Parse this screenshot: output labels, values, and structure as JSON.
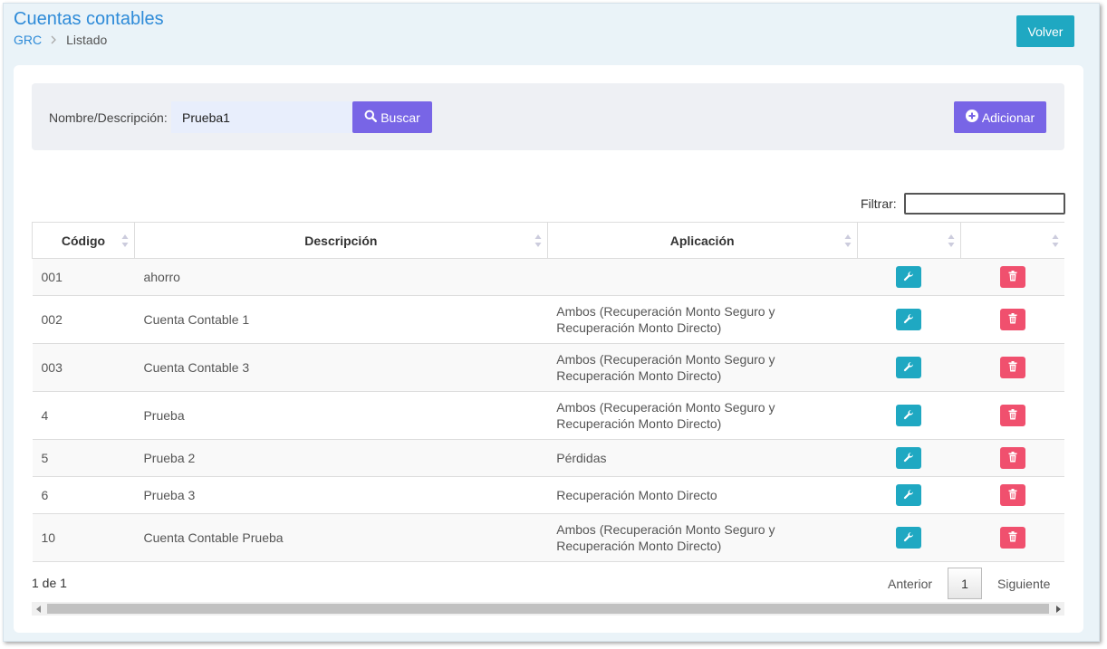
{
  "header": {
    "title": "Cuentas contables",
    "breadcrumb": {
      "root": "GRC",
      "current": "Listado"
    },
    "back_label": "Volver"
  },
  "search": {
    "label": "Nombre/Descripción:",
    "value": "Prueba1",
    "search_label": "Buscar",
    "add_label": "Adicionar"
  },
  "filter": {
    "label": "Filtrar:",
    "value": ""
  },
  "table": {
    "columns": [
      "Código",
      "Descripción",
      "Aplicación",
      "",
      ""
    ],
    "rows": [
      {
        "code": "001",
        "description": "ahorro",
        "application_1": "",
        "application_2": ""
      },
      {
        "code": "002",
        "description": "Cuenta Contable 1",
        "application_1": "Ambos (Recuperación Monto Seguro y",
        "application_2": "Recuperación Monto Directo)"
      },
      {
        "code": "003",
        "description": "Cuenta Contable 3",
        "application_1": "Ambos (Recuperación Monto Seguro y",
        "application_2": "Recuperación Monto Directo)"
      },
      {
        "code": "4",
        "description": "Prueba",
        "application_1": "Ambos (Recuperación Monto Seguro y",
        "application_2": "Recuperación Monto Directo)"
      },
      {
        "code": "5",
        "description": "Prueba 2",
        "application_1": "Pérdidas",
        "application_2": ""
      },
      {
        "code": "6",
        "description": "Prueba 3",
        "application_1": "Recuperación Monto Directo",
        "application_2": ""
      },
      {
        "code": "10",
        "description": "Cuenta Contable Prueba",
        "application_1": "Ambos (Recuperación Monto Seguro y",
        "application_2": "Recuperación Monto Directo)"
      }
    ]
  },
  "pagination": {
    "info": "1 de 1",
    "previous": "Anterior",
    "current_page": "1",
    "next": "Siguiente"
  },
  "colors": {
    "accent_teal": "#1fa8c2",
    "accent_purple": "#7865e6",
    "danger": "#f0506e",
    "title_blue": "#2e8bd8"
  },
  "icons": {
    "search": "search-icon",
    "add": "plus-circle-icon",
    "edit": "wrench-icon",
    "delete": "trash-icon"
  }
}
